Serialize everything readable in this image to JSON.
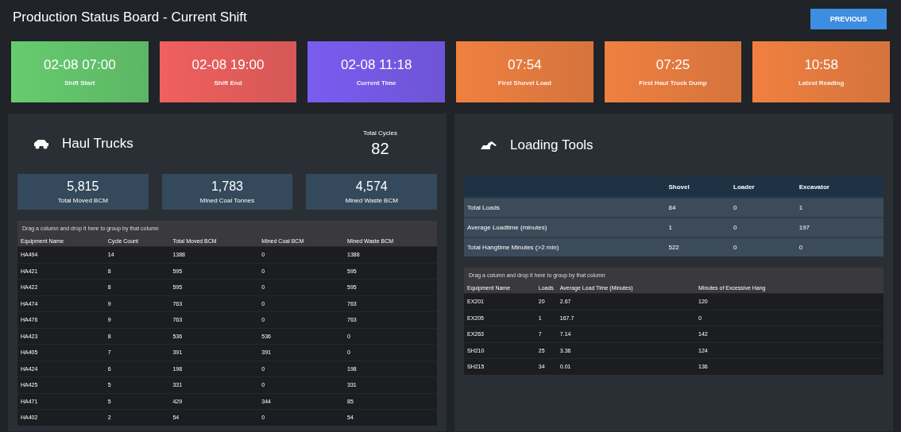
{
  "header": {
    "title": "Production Status Board - Current Shift",
    "button": "PREVIOUS"
  },
  "tiles": [
    {
      "value": "02-08 07:00",
      "label": "Shift Start",
      "color": "#66cc6e"
    },
    {
      "value": "02-08 19:00",
      "label": "Shift End",
      "color": "#f0605e"
    },
    {
      "value": "02-08 11:18",
      "label": "Current Time",
      "color": "#7a5cf0"
    },
    {
      "value": "07:54",
      "label": "First Shovel Load",
      "color": "#f08040"
    },
    {
      "value": "07:25",
      "label": "First Haul Truck Dump",
      "color": "#f08040"
    },
    {
      "value": "10:58",
      "label": "Latest Reading",
      "color": "#f08040"
    }
  ],
  "haul_trucks": {
    "title": "Haul Trucks",
    "total_cycles_label": "Total Cycles",
    "total_cycles": "82",
    "stats": [
      {
        "value": "5,815",
        "label": "Total Moved BCM"
      },
      {
        "value": "1,783",
        "label": "Mined Coal Tonnes"
      },
      {
        "value": "4,574",
        "label": "Mined Waste BCM"
      }
    ],
    "group_hint": "Drag a column and drop it here to group by that column",
    "columns": [
      "Equipment Name",
      "Cycle Count",
      "Total Moved BCM",
      "Mined Coal BCM",
      "Mined Waste BCM"
    ],
    "rows": [
      [
        "HA494",
        "14",
        "1388",
        "0",
        "1388"
      ],
      [
        "HA421",
        "8",
        "595",
        "0",
        "595"
      ],
      [
        "HA422",
        "8",
        "595",
        "0",
        "595"
      ],
      [
        "HA474",
        "9",
        "763",
        "0",
        "763"
      ],
      [
        "HA476",
        "9",
        "763",
        "0",
        "763"
      ],
      [
        "HA423",
        "8",
        "536",
        "536",
        "0"
      ],
      [
        "HA405",
        "7",
        "391",
        "391",
        "0"
      ],
      [
        "HA424",
        "6",
        "198",
        "0",
        "198"
      ],
      [
        "HA425",
        "5",
        "331",
        "0",
        "331"
      ],
      [
        "HA471",
        "5",
        "429",
        "344",
        "85"
      ],
      [
        "HA402",
        "2",
        "54",
        "0",
        "54"
      ]
    ]
  },
  "loading_tools": {
    "title": "Loading Tools",
    "summary_columns": [
      "Shovel",
      "Loader",
      "Excavator"
    ],
    "summary_rows": [
      {
        "label": "Total Loads",
        "values": [
          "84",
          "0",
          "1"
        ]
      },
      {
        "label": "Average Loadtime (minutes)",
        "values": [
          "1",
          "0",
          "197"
        ]
      },
      {
        "label": "Total Hangtime Minutes (>2 min)",
        "values": [
          "522",
          "0",
          "0"
        ]
      }
    ],
    "group_hint": "Drag a column and drop it here to group by that column",
    "columns": [
      "Equipment Name",
      "Loads",
      "Average Load Time (Minutes)",
      "Minutes of Excessive Hang"
    ],
    "rows": [
      [
        "EX201",
        "20",
        "2.67",
        "120"
      ],
      [
        "EX205",
        "1",
        "167.7",
        "0"
      ],
      [
        "EX263",
        "7",
        "7.14",
        "142"
      ],
      [
        "SH210",
        "25",
        "3.36",
        "124"
      ],
      [
        "SH215",
        "34",
        "0.01",
        "136"
      ]
    ]
  }
}
